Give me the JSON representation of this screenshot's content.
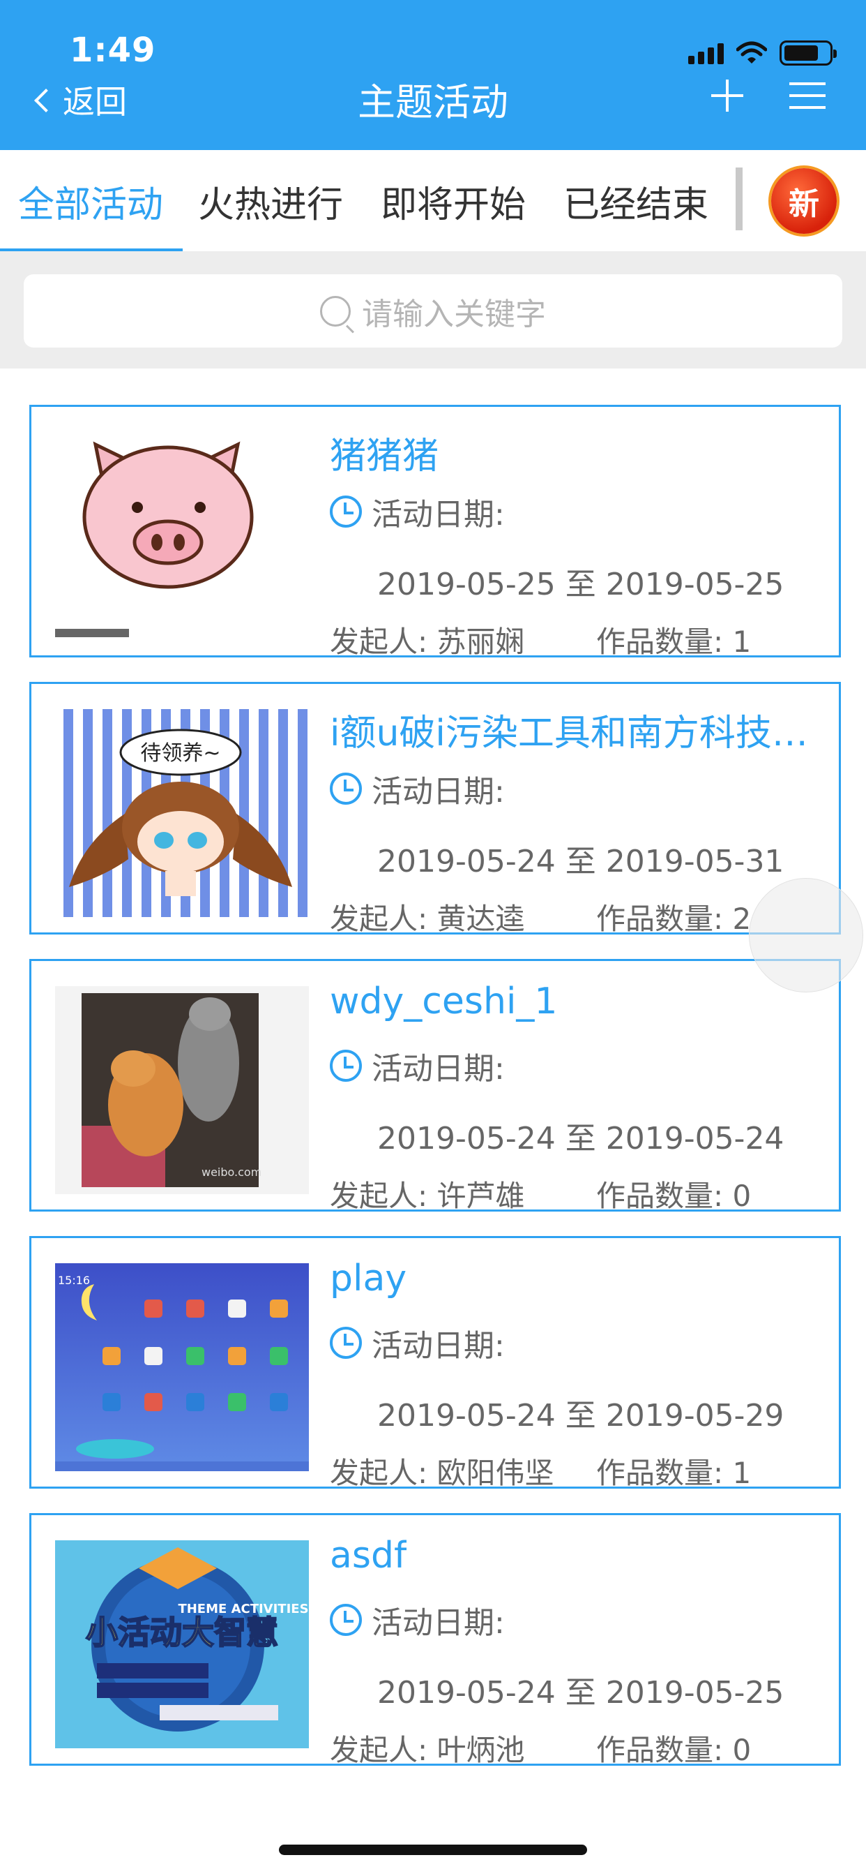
{
  "status": {
    "time": "1:49"
  },
  "header": {
    "back_label": "返回",
    "title": "主题活动"
  },
  "tabs": [
    {
      "label": "全部活动",
      "active": true
    },
    {
      "label": "火热进行"
    },
    {
      "label": "即将开始"
    },
    {
      "label": "已经结束"
    }
  ],
  "new_badge": "新",
  "search": {
    "placeholder": "请输入关键字"
  },
  "labels": {
    "date": "活动日期:",
    "range_sep": "至",
    "initiator": "发起人:",
    "count": "作品数量:"
  },
  "activities": [
    {
      "title": "猪猪猪",
      "start": "2019-05-25",
      "end": "2019-05-25",
      "initiator": "苏丽娴",
      "count": "1",
      "thumb_icon": "pig-cartoon"
    },
    {
      "title": "i额u破i污染工具和南方科技…",
      "start": "2019-05-24",
      "end": "2019-05-31",
      "initiator": "黄达逵",
      "count": "2",
      "thumb_icon": "girl-cartoon",
      "thumb_text": "待领养~"
    },
    {
      "title": "wdy_ceshi_1",
      "start": "2019-05-24",
      "end": "2019-05-24",
      "initiator": "许芦雄",
      "count": "0",
      "thumb_icon": "cats-photo"
    },
    {
      "title": "play",
      "start": "2019-05-24",
      "end": "2019-05-29",
      "initiator": "欧阳伟坚",
      "count": "1",
      "thumb_icon": "tablet-screenshot",
      "thumb_text": "15:16"
    },
    {
      "title": "asdf",
      "start": "2019-05-24",
      "end": "2019-05-25",
      "initiator": "叶炳池",
      "count": "0",
      "thumb_icon": "poster",
      "thumb_text": "小活动大智慧",
      "thumb_sub": "THEME ACTIVITIES"
    }
  ],
  "colors": {
    "primary": "#2EA2F2",
    "search_bg": "#ededed",
    "badge": "#d8220b"
  }
}
